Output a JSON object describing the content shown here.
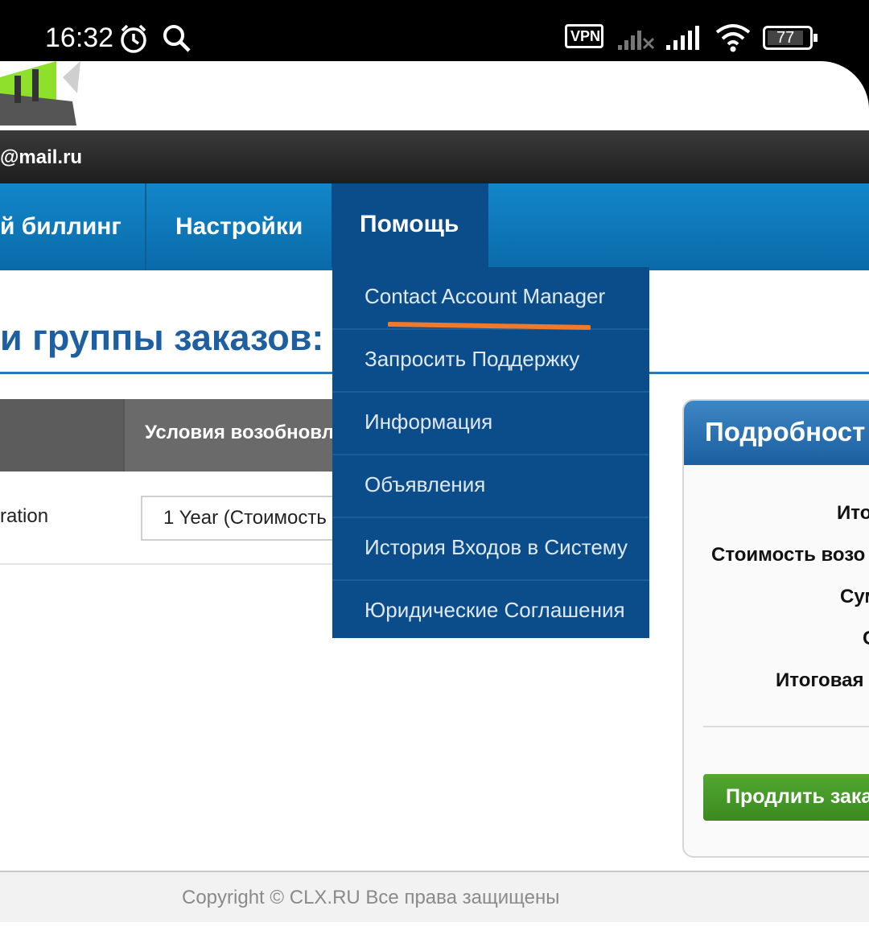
{
  "status_bar": {
    "time": "16:32",
    "vpn_label": "VPN",
    "battery": "77",
    "icons": [
      "alarm-icon",
      "search-icon",
      "vpn-icon",
      "signal-off-icon",
      "signal-icon",
      "wifi-icon",
      "battery-icon"
    ]
  },
  "user_bar": {
    "email": "@mail.ru"
  },
  "nav": {
    "items": [
      {
        "label": "й биллинг"
      },
      {
        "label": "Настройки"
      },
      {
        "label": "Помощь"
      }
    ]
  },
  "help_menu": {
    "items": [
      {
        "label": "Contact Account Manager"
      },
      {
        "label": "Запросить Поддержку"
      },
      {
        "label": "Информация"
      },
      {
        "label": "Объявления"
      },
      {
        "label": "История Входов в Систему"
      },
      {
        "label": "Юридические Соглашения"
      }
    ],
    "highlight_color": "#f07a2a"
  },
  "page": {
    "heading": "и группы заказов:",
    "table": {
      "header": "Условия возобновл",
      "row": {
        "name": "ration",
        "term": "1 Year (Стоимость"
      }
    }
  },
  "summary": {
    "title": "Подробност",
    "lines": [
      "Ито",
      "Стоимость возо",
      "Сум",
      "С",
      "Итоговая"
    ],
    "button": "Продлить зака"
  },
  "footer": {
    "copyright": "Copyright © CLX.RU Все права защищены"
  },
  "colors": {
    "nav": "#0a75b8",
    "menu": "#0b4d8a",
    "button": "#4a9e2a",
    "heading": "#1d5fa0"
  }
}
